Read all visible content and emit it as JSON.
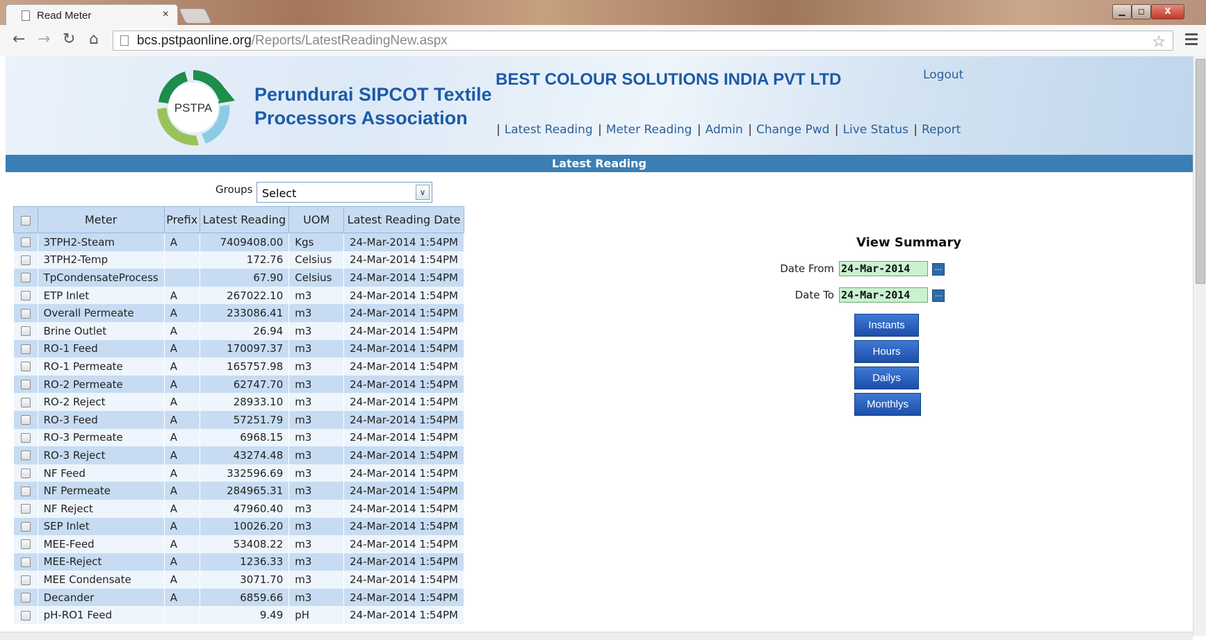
{
  "browser": {
    "tab_title": "Read Meter",
    "tab_close": "×",
    "url_host": "bcs.pstpaonline.org",
    "url_path": "/Reports/LatestReadingNew.aspx",
    "window_controls": {
      "minimize": "▁",
      "maximize": "◻",
      "close": "X"
    }
  },
  "header": {
    "logo_text": "PSTPA",
    "org_line1": "Perundurai SIPCOT Textile",
    "org_line2": "Processors Association",
    "company": "BEST COLOUR SOLUTIONS INDIA PVT LTD",
    "logout": "Logout",
    "nav": [
      "Latest Reading",
      "Meter Reading",
      "Admin",
      "Change Pwd",
      "Live Status",
      "Report"
    ]
  },
  "section_title": "Latest Reading",
  "filters": {
    "groups_label": "Groups",
    "groups_value": "Select"
  },
  "table": {
    "columns": [
      "Meter",
      "Prefix",
      "Latest Reading",
      "UOM",
      "Latest Reading Date"
    ],
    "rows": [
      [
        "3TPH2-Steam",
        "A",
        "7409408.00",
        "Kgs",
        "24-Mar-2014 1:54PM"
      ],
      [
        "3TPH2-Temp",
        "",
        "172.76",
        "Celsius",
        "24-Mar-2014 1:54PM"
      ],
      [
        "TpCondensateProcess",
        "",
        "67.90",
        "Celsius",
        "24-Mar-2014 1:54PM"
      ],
      [
        "ETP Inlet",
        "A",
        "267022.10",
        "m3",
        "24-Mar-2014 1:54PM"
      ],
      [
        "Overall Permeate",
        "A",
        "233086.41",
        "m3",
        "24-Mar-2014 1:54PM"
      ],
      [
        "Brine Outlet",
        "A",
        "26.94",
        "m3",
        "24-Mar-2014 1:54PM"
      ],
      [
        "RO-1 Feed",
        "A",
        "170097.37",
        "m3",
        "24-Mar-2014 1:54PM"
      ],
      [
        "RO-1 Permeate",
        "A",
        "165757.98",
        "m3",
        "24-Mar-2014 1:54PM"
      ],
      [
        "RO-2 Permeate",
        "A",
        "62747.70",
        "m3",
        "24-Mar-2014 1:54PM"
      ],
      [
        "RO-2 Reject",
        "A",
        "28933.10",
        "m3",
        "24-Mar-2014 1:54PM"
      ],
      [
        "RO-3 Feed",
        "A",
        "57251.79",
        "m3",
        "24-Mar-2014 1:54PM"
      ],
      [
        "RO-3 Permeate",
        "A",
        "6968.15",
        "m3",
        "24-Mar-2014 1:54PM"
      ],
      [
        "RO-3 Reject",
        "A",
        "43274.48",
        "m3",
        "24-Mar-2014 1:54PM"
      ],
      [
        "NF Feed",
        "A",
        "332596.69",
        "m3",
        "24-Mar-2014 1:54PM"
      ],
      [
        "NF Permeate",
        "A",
        "284965.31",
        "m3",
        "24-Mar-2014 1:54PM"
      ],
      [
        "NF Reject",
        "A",
        "47960.40",
        "m3",
        "24-Mar-2014 1:54PM"
      ],
      [
        "SEP Inlet",
        "A",
        "10026.20",
        "m3",
        "24-Mar-2014 1:54PM"
      ],
      [
        "MEE-Feed",
        "A",
        "53408.22",
        "m3",
        "24-Mar-2014 1:54PM"
      ],
      [
        "MEE-Reject",
        "A",
        "1236.33",
        "m3",
        "24-Mar-2014 1:54PM"
      ],
      [
        "MEE Condensate",
        "A",
        "3071.70",
        "m3",
        "24-Mar-2014 1:54PM"
      ],
      [
        "Decander",
        "A",
        "6859.66",
        "m3",
        "24-Mar-2014 1:54PM"
      ],
      [
        "pH-RO1 Feed",
        "",
        "9.49",
        "pH",
        "24-Mar-2014 1:54PM"
      ]
    ]
  },
  "summary": {
    "title": "View Summary",
    "date_from_label": "Date From",
    "date_from": "24-Mar-2014",
    "date_to_label": "Date To",
    "date_to": "24-Mar-2014",
    "calendar_button": "...",
    "buttons": {
      "instants": "Instants",
      "hours": "Hours",
      "dailys": "Dailys",
      "monthlys": "Monthlys"
    }
  },
  "colors": {
    "section_bar": "#3a7fb5",
    "org_text": "#1e5aa8",
    "button": "#2a5fbd",
    "date_field": "#c9f2cf"
  }
}
